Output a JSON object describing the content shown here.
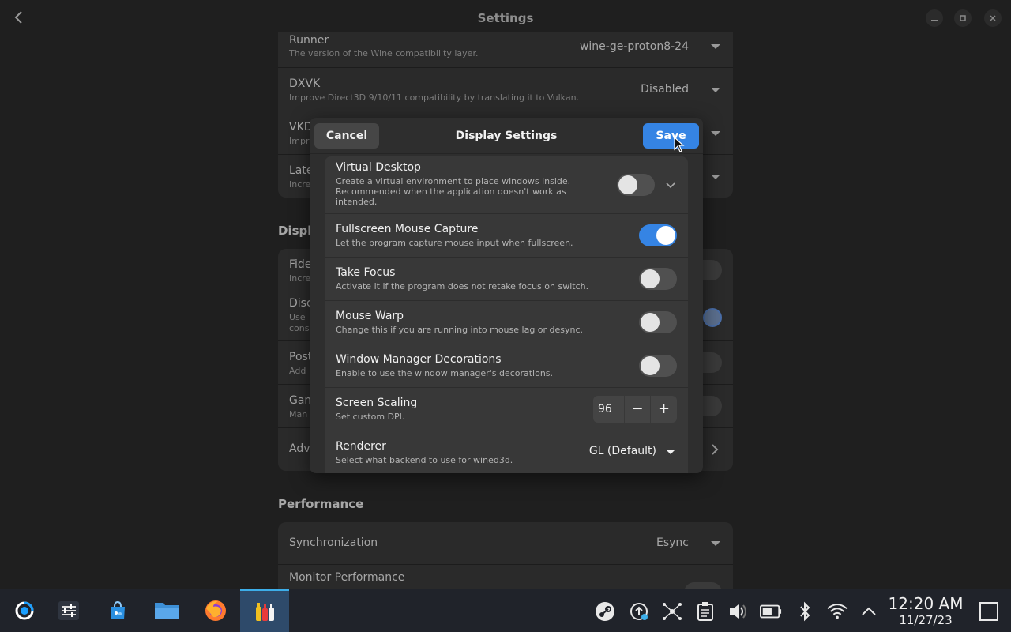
{
  "window": {
    "title": "Settings"
  },
  "background": {
    "rows": [
      {
        "title": "Runner",
        "subtitle": "The version of the Wine compatibility layer.",
        "value": "wine-ge-proton8-24"
      },
      {
        "title": "DXVK",
        "subtitle": "Improve Direct3D 9/10/11 compatibility by translating it to Vulkan.",
        "value": "Disabled"
      },
      {
        "title": "VKD",
        "subtitle": "Impr"
      },
      {
        "title": "Late",
        "subtitle": "Incre"
      }
    ],
    "display_section": "Displ",
    "display_rows": [
      {
        "title": "Fide",
        "subtitle": "Incre"
      },
      {
        "title": "Disc",
        "subtitle": "Use",
        "subtitle2": "cons"
      },
      {
        "title": "Post",
        "subtitle": "Add"
      },
      {
        "title": "Gam",
        "subtitle": "Man"
      },
      {
        "title": "Adv"
      }
    ],
    "performance_section": "Performance",
    "performance_rows": [
      {
        "title": "Synchronization",
        "value": "Esync"
      },
      {
        "title": "Monitor Performance"
      }
    ]
  },
  "dialog": {
    "title": "Display Settings",
    "cancel_label": "Cancel",
    "save_label": "Save",
    "rows": [
      {
        "title": "Virtual Desktop",
        "subtitle": "Create a virtual environment to place windows inside. Recommended when the application doesn't work as intended.",
        "enabled": false
      },
      {
        "title": "Fullscreen Mouse Capture",
        "subtitle": "Let the program capture mouse input when fullscreen.",
        "enabled": true
      },
      {
        "title": "Take Focus",
        "subtitle": "Activate it if the program does not retake focus on switch.",
        "enabled": false
      },
      {
        "title": "Mouse Warp",
        "subtitle": "Change this if you are running into mouse lag or desync.",
        "enabled": false
      },
      {
        "title": "Window Manager Decorations",
        "subtitle": "Enable to use the window manager's decorations.",
        "enabled": false
      }
    ],
    "scaling": {
      "title": "Screen Scaling",
      "subtitle": "Set custom DPI.",
      "value": "96",
      "minus": "−",
      "plus": "+"
    },
    "renderer": {
      "title": "Renderer",
      "subtitle": "Select what backend to use for wined3d.",
      "value": "GL (Default)"
    }
  },
  "taskbar": {
    "apps": [
      "application-launcher-icon",
      "system-settings-icon",
      "discover-store-icon",
      "file-manager-icon",
      "firefox-icon",
      "bottles-icon"
    ],
    "tray": [
      "steam-icon",
      "update-icon",
      "network-graph-icon",
      "clipboard-icon",
      "volume-icon",
      "battery-icon",
      "bluetooth-icon",
      "wifi-icon",
      "expand-tray-icon"
    ],
    "time": "12:20 AM",
    "date": "11/27/23",
    "accent": "#3daee9"
  },
  "colors": {
    "accent": "#3584e4",
    "dialog_bg": "#2e2e2e",
    "row_bg": "#383838"
  }
}
